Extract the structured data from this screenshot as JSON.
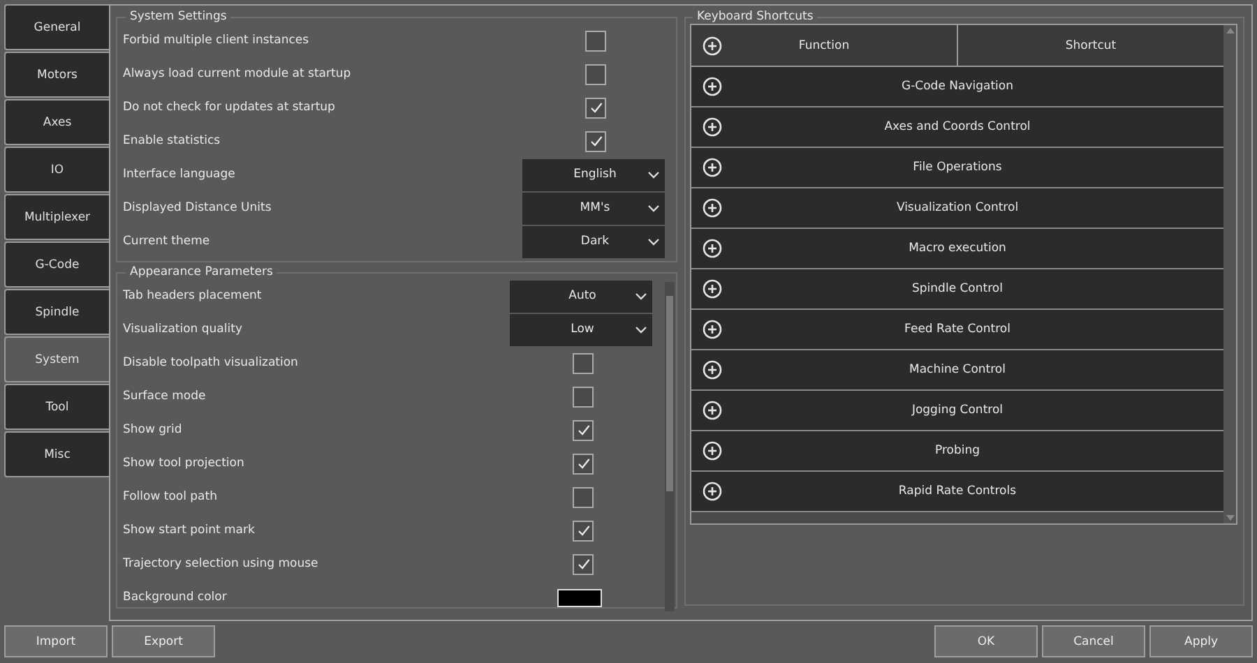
{
  "tabs": [
    {
      "label": "General",
      "selected": false
    },
    {
      "label": "Motors",
      "selected": false
    },
    {
      "label": "Axes",
      "selected": false
    },
    {
      "label": "IO",
      "selected": false
    },
    {
      "label": "Multiplexer",
      "selected": false
    },
    {
      "label": "G-Code",
      "selected": false
    },
    {
      "label": "Spindle",
      "selected": false
    },
    {
      "label": "System",
      "selected": true
    },
    {
      "label": "Tool",
      "selected": false
    },
    {
      "label": "Misc",
      "selected": false
    }
  ],
  "system_settings": {
    "title": "System Settings",
    "rows": [
      {
        "kind": "checkbox",
        "label": "Forbid multiple client instances",
        "checked": false
      },
      {
        "kind": "checkbox",
        "label": "Always load current module at startup",
        "checked": false
      },
      {
        "kind": "checkbox",
        "label": "Do not check for updates at startup",
        "checked": true
      },
      {
        "kind": "checkbox",
        "label": "Enable statistics",
        "checked": true
      },
      {
        "kind": "dropdown",
        "label": "Interface language",
        "value": "English"
      },
      {
        "kind": "dropdown",
        "label": "Displayed Distance Units",
        "value": "MM's"
      },
      {
        "kind": "dropdown",
        "label": "Current theme",
        "value": "Dark"
      }
    ]
  },
  "appearance_parameters": {
    "title": "Appearance Parameters",
    "rows": [
      {
        "kind": "dropdown",
        "label": "Tab headers placement",
        "value": "Auto"
      },
      {
        "kind": "dropdown",
        "label": "Visualization quality",
        "value": "Low"
      },
      {
        "kind": "checkbox",
        "label": "Disable toolpath visualization",
        "checked": false
      },
      {
        "kind": "checkbox",
        "label": "Surface mode",
        "checked": false
      },
      {
        "kind": "checkbox",
        "label": "Show grid",
        "checked": true
      },
      {
        "kind": "checkbox",
        "label": "Show tool projection",
        "checked": true
      },
      {
        "kind": "checkbox",
        "label": "Follow tool path",
        "checked": false
      },
      {
        "kind": "checkbox",
        "label": "Show start point mark",
        "checked": true
      },
      {
        "kind": "checkbox",
        "label": "Trajectory selection using mouse",
        "checked": true
      },
      {
        "kind": "color",
        "label": "Background color",
        "color": "#000000"
      }
    ]
  },
  "keyboard_shortcuts": {
    "title": "Keyboard Shortcuts",
    "columns": [
      "Function",
      "Shortcut"
    ],
    "groups": [
      {
        "label": "G-Code Navigation",
        "expanded": false
      },
      {
        "label": "Axes and Coords Control",
        "expanded": false
      },
      {
        "label": "File Operations",
        "expanded": false
      },
      {
        "label": "Visualization Control",
        "expanded": false
      },
      {
        "label": "Macro execution",
        "expanded": false
      },
      {
        "label": "Spindle Control",
        "expanded": false
      },
      {
        "label": "Feed Rate Control",
        "expanded": false
      },
      {
        "label": "Machine Control",
        "expanded": false
      },
      {
        "label": "Jogging Control",
        "expanded": false
      },
      {
        "label": "Probing",
        "expanded": false
      },
      {
        "label": "Rapid Rate Controls",
        "expanded": false
      }
    ]
  },
  "left_buttons": [
    "Import",
    "Export"
  ],
  "right_buttons": [
    "OK",
    "Cancel",
    "Apply"
  ]
}
